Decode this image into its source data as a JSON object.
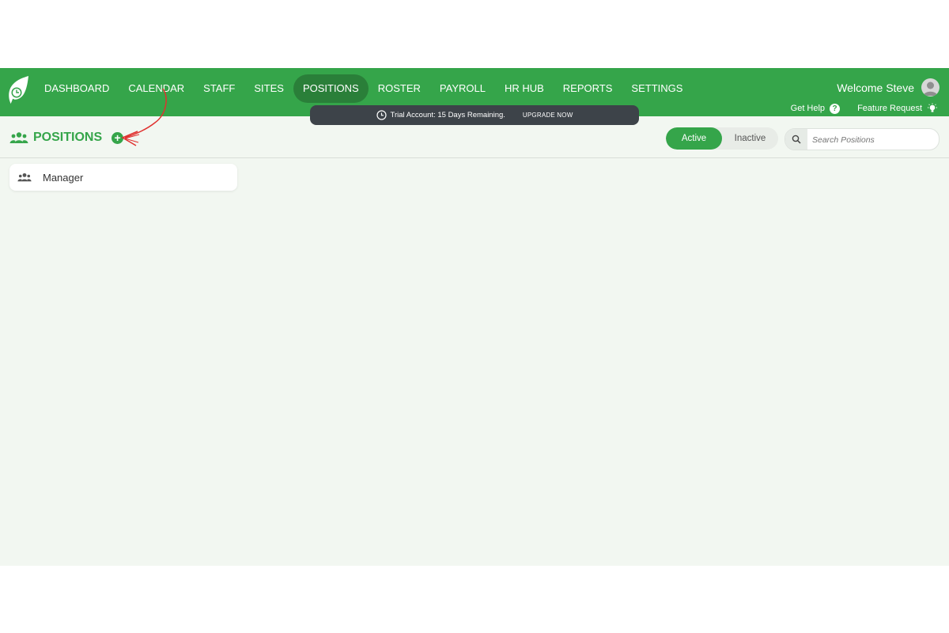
{
  "nav": {
    "items": [
      {
        "label": "DASHBOARD"
      },
      {
        "label": "CALENDAR"
      },
      {
        "label": "STAFF"
      },
      {
        "label": "SITES"
      },
      {
        "label": "POSITIONS",
        "active": true
      },
      {
        "label": "ROSTER"
      },
      {
        "label": "PAYROLL"
      },
      {
        "label": "HR HUB"
      },
      {
        "label": "REPORTS"
      },
      {
        "label": "SETTINGS"
      }
    ]
  },
  "user": {
    "welcome": "Welcome Steve",
    "help_label": "Get Help",
    "feature_label": "Feature Request"
  },
  "trial": {
    "message": "Trial Account: 15 Days Remaining.",
    "upgrade_label": "UPGRADE NOW"
  },
  "page": {
    "title": "POSITIONS",
    "filter": {
      "active_label": "Active",
      "inactive_label": "Inactive",
      "selected": "Active"
    },
    "search": {
      "placeholder": "Search Positions",
      "value": ""
    }
  },
  "positions": [
    {
      "name": "Manager"
    }
  ],
  "colors": {
    "brand_green": "#35a54a",
    "nav_active": "#2a7f39",
    "banner": "#3d4349",
    "background": "#f2f7f1",
    "annotation_red": "#e0312f"
  },
  "icons": {
    "logo": "leaf-clock-logo",
    "title": "users-group-icon",
    "add": "plus-circle-icon",
    "help": "question-circle-icon",
    "feature": "lightbulb-icon",
    "banner": "clock-icon",
    "search": "search-icon"
  }
}
